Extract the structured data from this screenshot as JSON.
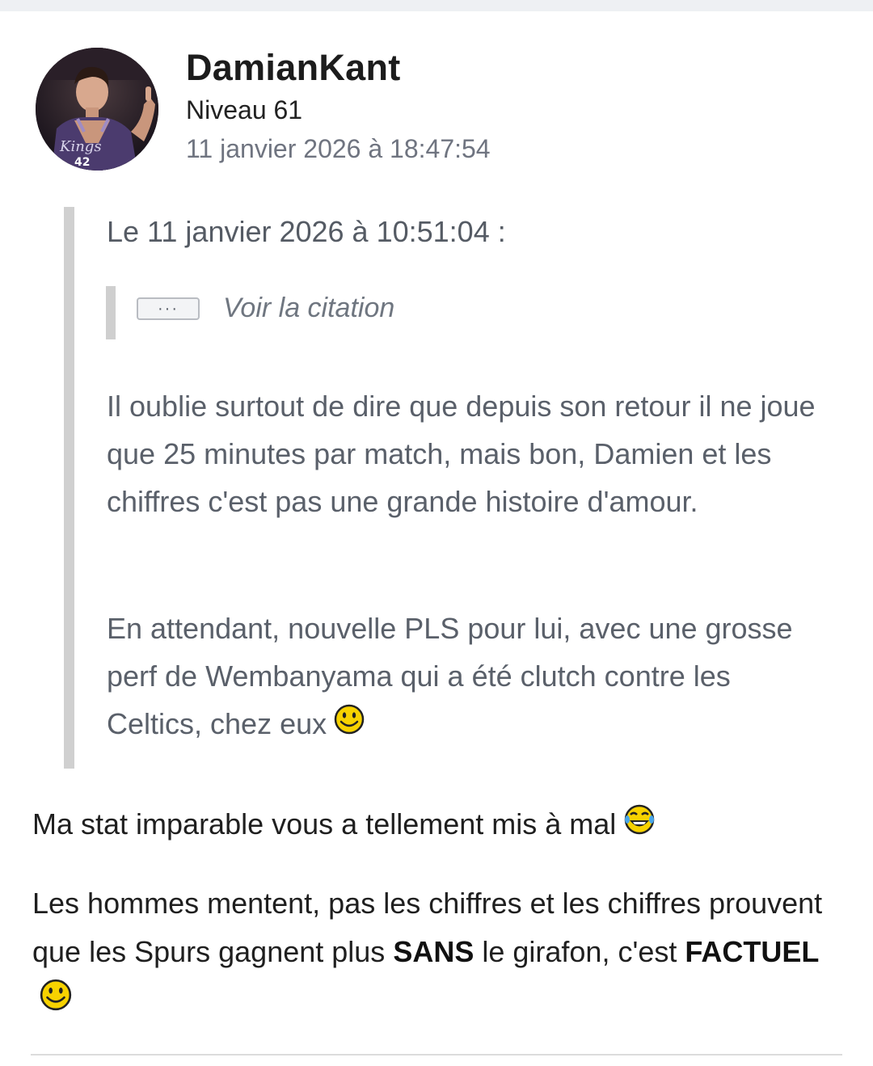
{
  "post": {
    "author": "DamianKant",
    "level": "Niveau 61",
    "timestamp": "11 janvier 2026 à 18:47:54"
  },
  "quote": {
    "header": "Le 11 janvier 2026 à 10:51:04 :",
    "nested_button": "···",
    "nested_link": "Voir la citation",
    "paragraphs": [
      "Il oublie surtout de dire que depuis son retour il ne joue que 25 minutes par match, mais bon, Damien et les chiffres c'est pas une grande histoire d'amour.",
      "En attendant, nouvelle PLS pour lui, avec une grosse perf de Wembanyama qui a été clutch contre les Celtics, chez eux"
    ],
    "emoji": "smiley-icon"
  },
  "body": {
    "line1_text": "Ma stat imparable vous a tellement mis à mal",
    "line1_emoji": "laughing-crying-icon",
    "line2": {
      "part1": "Les hommes mentent, pas les chiffres et les chiffres prouvent que les Spurs gagnent plus ",
      "bold1": "SANS",
      "part2": " le girafon, c'est ",
      "bold2": "FACTUEL",
      "emoji": "smiley-icon"
    }
  },
  "colors": {
    "emoji_yellow": "#f7d200",
    "quote_bar": "#d0d0d0",
    "meta_gray": "#6f7480"
  }
}
